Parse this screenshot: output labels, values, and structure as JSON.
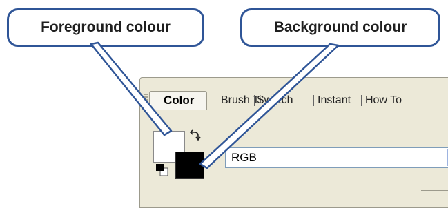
{
  "callouts": {
    "foreground": "Foreground colour",
    "background": "Background colour",
    "border_color": "#2f5597"
  },
  "panel": {
    "tabs": [
      {
        "label": "Color",
        "active": true
      },
      {
        "label": "Brush Ti",
        "active": false
      },
      {
        "label": "Swatch",
        "active": false
      },
      {
        "label": "Instant",
        "active": false
      },
      {
        "label": "How To",
        "active": false
      }
    ],
    "foreground_color": "#ffffff",
    "background_color": "#000000",
    "mode_select": {
      "value": "RGB"
    },
    "icons": [
      "swap-colors-icon",
      "default-colors-icon",
      "panel-grip-icon"
    ]
  }
}
